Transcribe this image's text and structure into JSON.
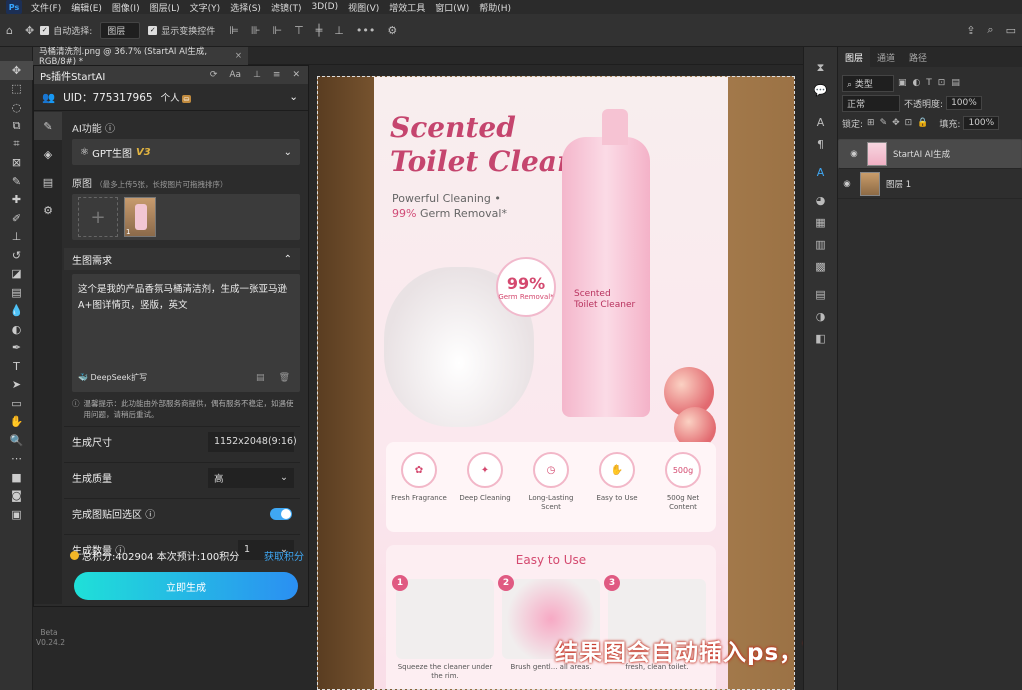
{
  "menubar": {
    "logo": "Ps",
    "items": [
      "文件(F)",
      "编辑(E)",
      "图像(I)",
      "图层(L)",
      "文字(Y)",
      "选择(S)",
      "滤镜(T)",
      "3D(D)",
      "视图(V)",
      "增效工具",
      "窗口(W)",
      "帮助(H)"
    ]
  },
  "options": {
    "auto_select_label": "自动选择:",
    "auto_select_value": "图层",
    "show_transform_label": "显示变换控件",
    "more": "•••"
  },
  "document": {
    "tab_title": "马桶清洗剂.png @ 36.7% (StartAI AI生成, RGB/8#) *"
  },
  "plugin": {
    "title": "Ps插件StartAI",
    "uid": "UID：775317965",
    "account_type": "个人",
    "vip_badge": "⛀",
    "ai_function_label": "AI功能",
    "ai_function_value": "GPT生图",
    "ai_function_version": "V3",
    "source_label": "原图",
    "source_hint": "（最多上传5张，长按图片可拖拽排序）",
    "thumb_number": "1",
    "requirement_label": "生图需求",
    "prompt": "这个是我的产品香氛马桶清洁剂，生成一张亚马逊A+图详情页，竖版，英文",
    "deepseek_label": "DeepSeek扩写",
    "tip": "温馨提示：此功能由外部服务商提供，偶有服务不稳定，如遇使用问题，请稍后重试。",
    "size_label": "生成尺寸",
    "size_value": "1152x2048(9:16)",
    "quality_label": "生成质量",
    "quality_value": "高",
    "paste_label": "完成图贴回选区",
    "count_label": "生成数量",
    "count_value": "1",
    "points": "总积分:402904",
    "estimate": "本次预计:100积分",
    "get_points": "获取积分",
    "generate_button": "立即生成",
    "beta": "Beta",
    "version": "V0.24.2"
  },
  "poster": {
    "title_line1": "Scented",
    "title_line2": "Toilet Cleaner",
    "sub1": "Powerful Cleaning •",
    "sub2_pct": "99%",
    "sub2_rest": " Germ Removal*",
    "badge_pct": "99%",
    "badge_text": "Germ Removal*",
    "bottle_label1": "Scented",
    "bottle_label2": "Toilet Cleaner",
    "features": [
      {
        "icon": "flower-icon",
        "glyph": "✿",
        "label": "Fresh Fragrance"
      },
      {
        "icon": "sparkle-icon",
        "glyph": "✦",
        "label": "Deep Cleaning"
      },
      {
        "icon": "clock-icon",
        "glyph": "◷",
        "label": "Long-Lasting Scent"
      },
      {
        "icon": "hand-icon",
        "glyph": "✋",
        "label": "Easy to Use"
      },
      {
        "icon": "weight-icon",
        "glyph": "500g",
        "label": "500g Net Content"
      }
    ],
    "easy_title": "Easy to Use",
    "steps": [
      {
        "num": "1",
        "caption": "Squeeze the cleaner under the rim."
      },
      {
        "num": "2",
        "caption": "Brush gentl... all areas."
      },
      {
        "num": "3",
        "caption": "fresh, clean toilet."
      }
    ]
  },
  "caption": "结果图会自动插入ps，可在ps再调整",
  "layers_panel": {
    "tabs": [
      "图层",
      "通道",
      "路径"
    ],
    "kind": "类型",
    "blend_mode": "正常",
    "opacity_label": "不透明度:",
    "opacity_value": "100%",
    "lock_label": "锁定:",
    "fill_label": "填充:",
    "fill_value": "100%",
    "layers": [
      {
        "name": "StartAI AI生成",
        "selected": true
      },
      {
        "name": "图层 1",
        "selected": false
      }
    ]
  },
  "colors": {
    "accent": "#3fa7f3",
    "brand_pink": "#d4496f",
    "caption_red": "#c32c1c"
  }
}
